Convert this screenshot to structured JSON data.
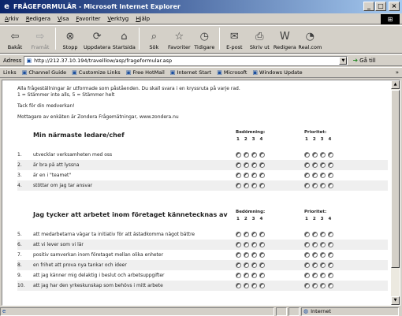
{
  "window": {
    "title": "FRÅGEFORMULÄR - Microsoft Internet Explorer"
  },
  "menu": [
    "Arkiv",
    "Redigera",
    "Visa",
    "Favoriter",
    "Verktyg",
    "Hjälp"
  ],
  "toolbar": [
    {
      "label": "Bakåt",
      "icon": "back-arrow-icon",
      "glyph": "⇦",
      "disabled": false
    },
    {
      "label": "Framåt",
      "icon": "forward-arrow-icon",
      "glyph": "⇨",
      "disabled": true
    },
    {
      "label": "Stopp",
      "icon": "stop-icon",
      "glyph": "⊗",
      "disabled": false
    },
    {
      "label": "Uppdatera",
      "icon": "refresh-icon",
      "glyph": "⟳",
      "disabled": false
    },
    {
      "label": "Startsida",
      "icon": "home-icon",
      "glyph": "⌂",
      "disabled": false
    },
    {
      "label": "Sök",
      "icon": "search-icon",
      "glyph": "⌕",
      "disabled": false
    },
    {
      "label": "Favoriter",
      "icon": "favorites-icon",
      "glyph": "☆",
      "disabled": false
    },
    {
      "label": "Tidigare",
      "icon": "history-icon",
      "glyph": "◷",
      "disabled": false
    },
    {
      "label": "E-post",
      "icon": "mail-icon",
      "glyph": "✉",
      "disabled": false
    },
    {
      "label": "Skriv ut",
      "icon": "print-icon",
      "glyph": "⎙",
      "disabled": false
    },
    {
      "label": "Redigera",
      "icon": "edit-icon",
      "glyph": "W",
      "disabled": false
    },
    {
      "label": "Real.com",
      "icon": "realcom-icon",
      "glyph": "◔",
      "disabled": false
    }
  ],
  "address": {
    "label": "Adress",
    "url": "http://212.37.10.194/travelllow/asp/frageformular.asp",
    "go": "Gå till"
  },
  "links": {
    "label": "Links",
    "items": [
      "Channel Guide",
      "Customize Links",
      "Free HotMail",
      "Internet Start",
      "Microsoft",
      "Windows Update"
    ],
    "chevron": "»"
  },
  "intro": {
    "line1": "Alla frågeställningar är utformade som påståenden. Du skall svara i en kryssruta på varje rad.",
    "line2": "1 = Stämmer inte alls, 5 = Stämmer helt",
    "line3": "Tack för din medverkan!",
    "line4": "Mottagare av enkäten är Zondera Frågemätningar, www.zondera.nu"
  },
  "sections": [
    {
      "title": "Min närmaste ledare/chef",
      "rating_label": "Bedömning:",
      "priority_label": "Prioritet:",
      "scale": [
        "1",
        "2",
        "3",
        "4"
      ],
      "questions": [
        {
          "num": "1.",
          "text": "utvecklar verksamheten med oss"
        },
        {
          "num": "2.",
          "text": "är bra på att lyssna"
        },
        {
          "num": "3.",
          "text": "är en i \"teamet\""
        },
        {
          "num": "4.",
          "text": "stöttar om jag tar ansvar"
        }
      ]
    },
    {
      "title": "Jag tycker att arbetet inom företaget kännetecknas av",
      "rating_label": "Bedömning:",
      "priority_label": "Prioritet:",
      "scale": [
        "1",
        "2",
        "3",
        "4"
      ],
      "questions": [
        {
          "num": "5.",
          "text": "att medarbetarna vågar ta initiativ för att åstadkomma något bättre"
        },
        {
          "num": "6.",
          "text": "att vi lever som vi lär"
        },
        {
          "num": "7.",
          "text": "positiv samverkan inom företaget mellan olika enheter"
        },
        {
          "num": "8.",
          "text": "en frihet att prova nya tankar och ideer"
        },
        {
          "num": "9.",
          "text": "att jag känner mig delaktig i beslut och arbetsuppgifter"
        },
        {
          "num": "10.",
          "text": "att jag har den yrkeskunskap som behövs i mitt arbete"
        }
      ]
    }
  ],
  "status": {
    "zone": "Internet"
  }
}
